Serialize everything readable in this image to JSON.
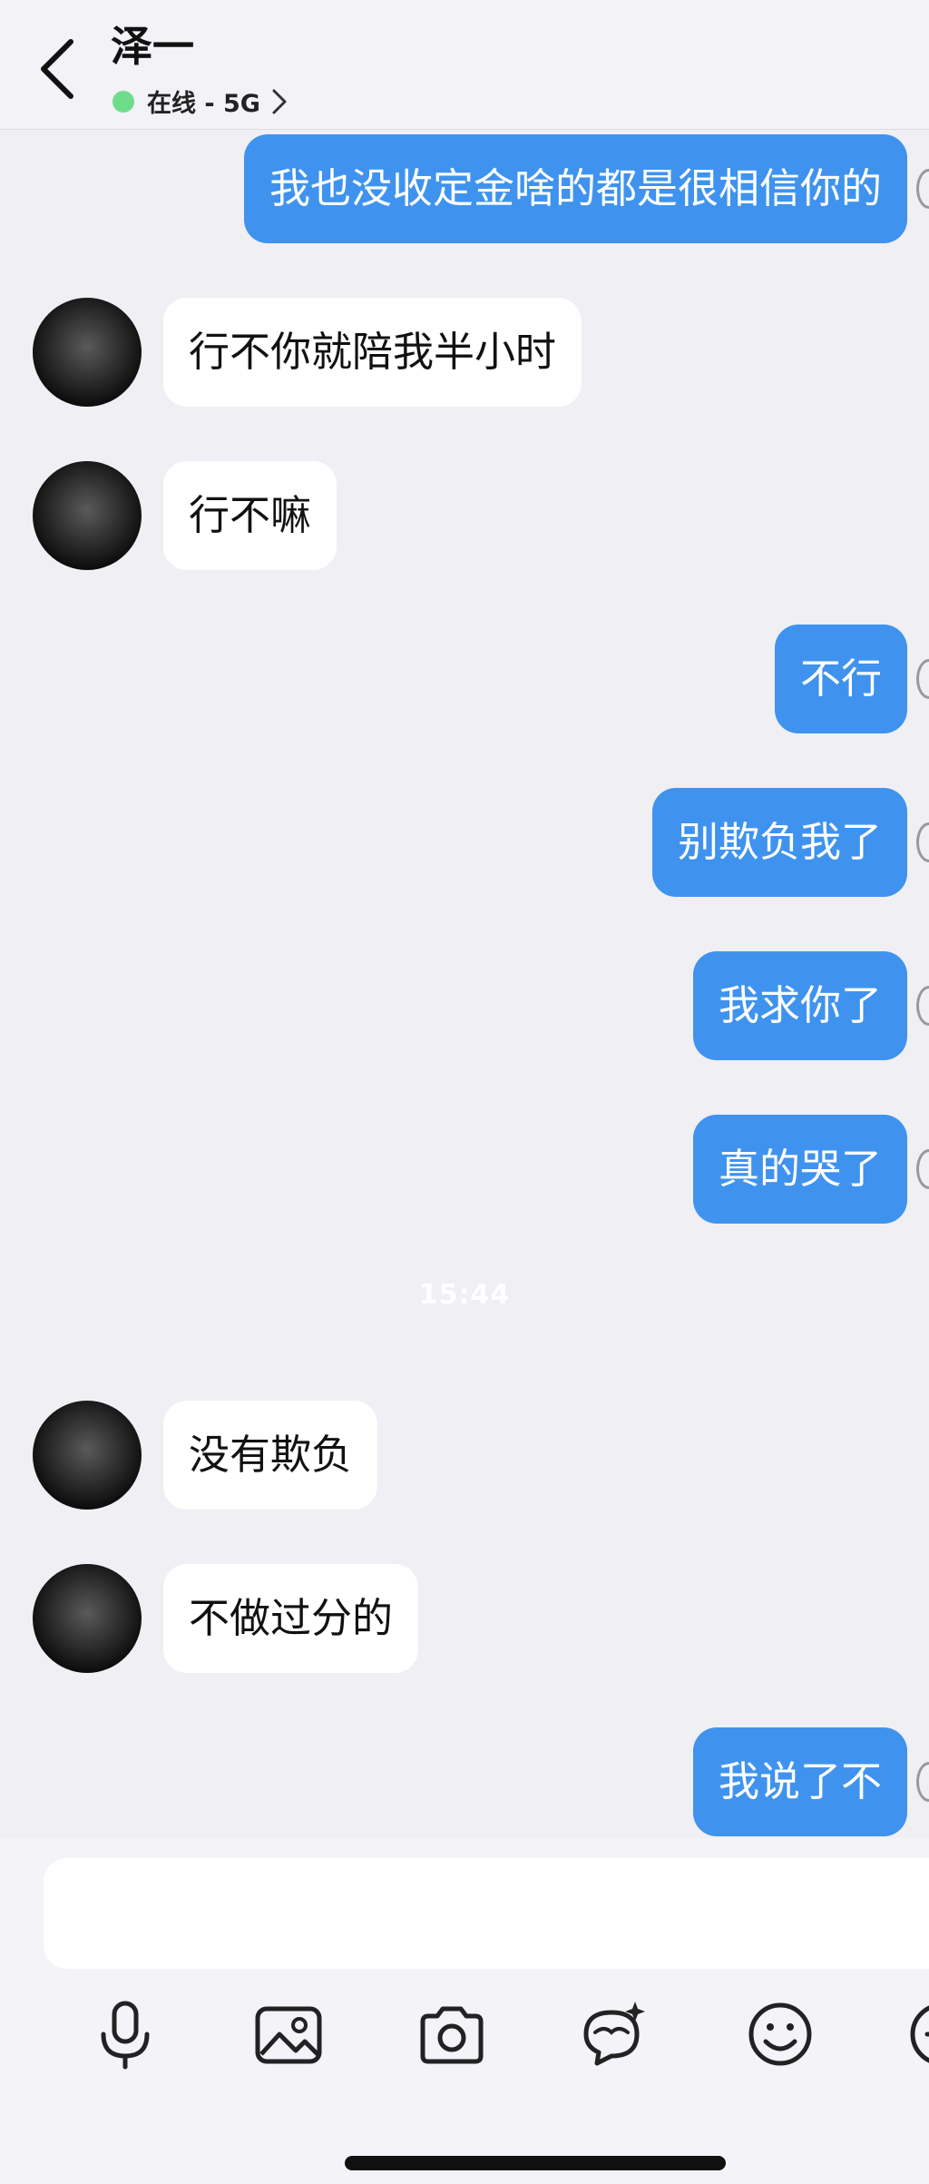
{
  "header": {
    "contact_name": "泽一",
    "status_text": "在线 - 5G"
  },
  "messages": [
    {
      "dir": "out",
      "text": "我也没收定金啥的都是很相信你的"
    },
    {
      "dir": "in",
      "text": "行不你就陪我半小时"
    },
    {
      "dir": "in",
      "text": "行不嘛"
    },
    {
      "dir": "out",
      "text": "不行"
    },
    {
      "dir": "out",
      "text": "别欺负我了"
    },
    {
      "dir": "out",
      "text": "我求你了"
    },
    {
      "dir": "out",
      "text": "真的哭了"
    },
    {
      "dir": "in",
      "text": "没有欺负"
    },
    {
      "dir": "in",
      "text": "不做过分的"
    },
    {
      "dir": "out",
      "text": "我说了不"
    }
  ],
  "timestamp": "15:44",
  "input": {
    "placeholder": ""
  },
  "toolbar": [
    "microphone-icon",
    "image-icon",
    "camera-icon",
    "ai-sticker-icon",
    "emoji-icon",
    "more-icon"
  ],
  "colors": {
    "outgoing_bubble": "#3f93ee",
    "incoming_bubble": "#ffffff",
    "online_dot": "#6fdc8c",
    "background": "#efeff4"
  }
}
